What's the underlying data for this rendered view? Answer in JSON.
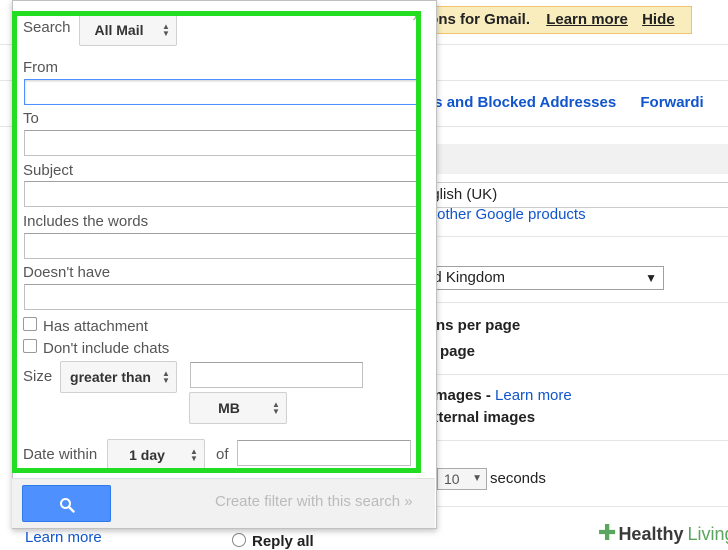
{
  "background": {
    "banner_text": "ions for Gmail.",
    "banner_learn_more": "Learn more",
    "banner_hide": "Hide",
    "tab_filters": "ers and Blocked Addresses",
    "tab_forwarding": "Forwardi",
    "language_value": "nglish (UK)",
    "language_link": "r other Google products",
    "country_value": "ed Kingdom",
    "conversations_per_page": "ns per page",
    "per_page": "r page",
    "images_label": " images - ",
    "images_learn_more": "Learn more",
    "external_images": "xternal images",
    "seconds_value": "10",
    "seconds_label": "seconds",
    "reply_all": "Reply all",
    "learn_more_bottom": "Learn more"
  },
  "dialog": {
    "search_label": "Search",
    "search_scope": "All Mail",
    "from_label": "From",
    "to_label": "To",
    "subject_label": "Subject",
    "includes_label": "Includes the words",
    "doesnt_have_label": "Doesn't have",
    "has_attachment_label": "Has attachment",
    "dont_include_chats_label": "Don't include chats",
    "size_label": "Size",
    "size_operator": "greater than",
    "size_unit": "MB",
    "date_within_label": "Date within",
    "date_within_value": "1 day",
    "of_label": "of",
    "create_filter": "Create filter with this search »",
    "close": "×"
  },
  "watermark": {
    "brand_a": "Healthy",
    "brand_b": "Living"
  },
  "colors": {
    "highlight": "#22dd22",
    "search_button": "#4d90fe",
    "link": "#1155cc"
  }
}
